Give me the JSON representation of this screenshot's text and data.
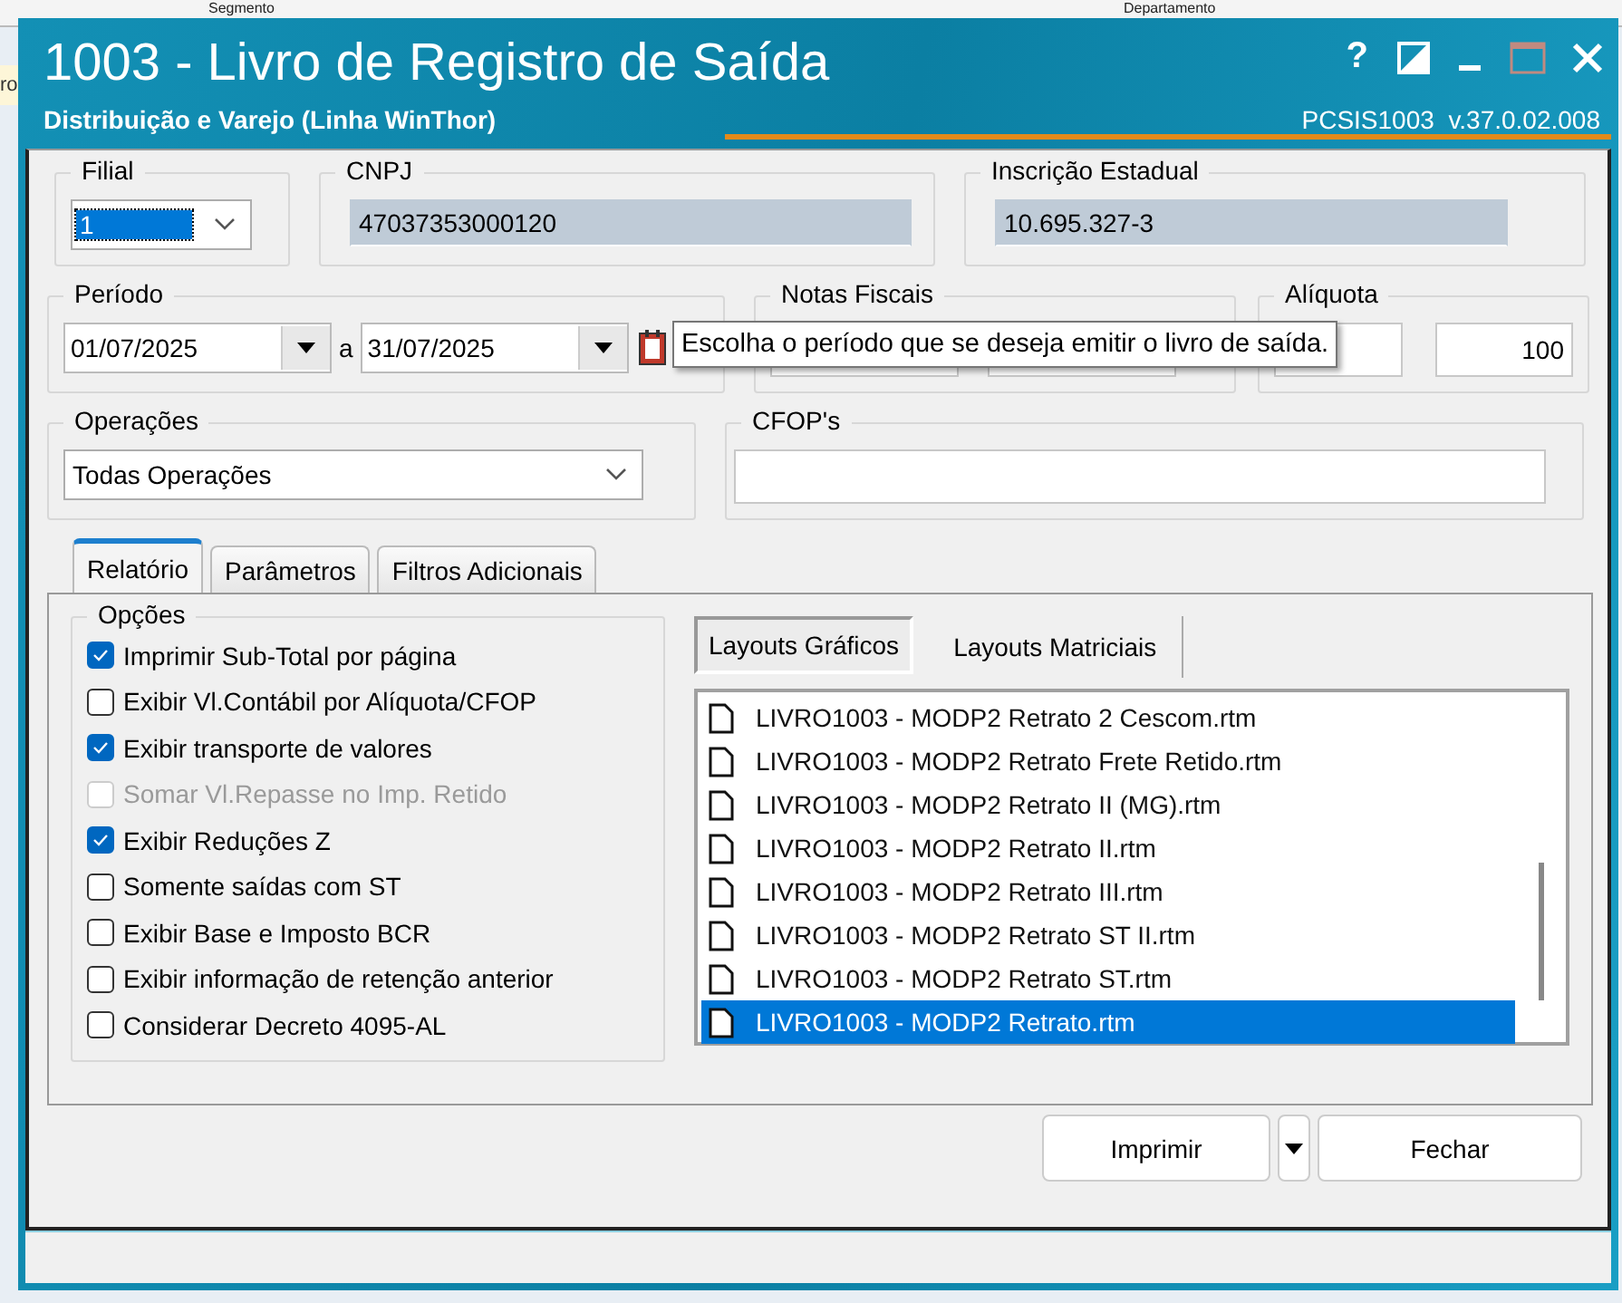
{
  "background": {
    "texts": [
      "Segmento",
      "Departamento",
      "ro"
    ]
  },
  "window": {
    "title": "1003 - Livro de Registro de Saída",
    "subtitle": "Distribuição e Varejo (Linha WinThor)",
    "help": "?",
    "version": "PCSIS1003  v.37.0.02.008"
  },
  "filial": {
    "label": "Filial",
    "value": "1",
    "value_selected": true
  },
  "cnpj": {
    "label": "CNPJ",
    "value": "47037353000120"
  },
  "inscricao": {
    "label": "Inscrição Estadual",
    "value": "10.695.327-3"
  },
  "periodo": {
    "label": "Período",
    "from": "01/07/2025",
    "separator": "a",
    "to": "31/07/2025"
  },
  "notas_fiscais": {
    "label": "Notas Fiscais"
  },
  "aliquota": {
    "label": "Alíquota",
    "to": "100"
  },
  "tooltip": {
    "text": "Escolha o período que se deseja emitir o livro de saída."
  },
  "operacoes": {
    "label": "Operações",
    "value": "Todas Operações"
  },
  "cfops": {
    "label": "CFOP's"
  },
  "tabs": [
    {
      "label": "Relatório",
      "selected": true
    },
    {
      "label": "Parâmetros",
      "selected": false
    },
    {
      "label": "Filtros Adicionais",
      "selected": false
    }
  ],
  "options": {
    "title": "Opções",
    "items": [
      {
        "label": "Imprimir Sub-Total por página",
        "checked": true,
        "disabled": false
      },
      {
        "label": "Exibir Vl.Contábil por Alíquota/CFOP",
        "checked": false,
        "disabled": false
      },
      {
        "label": "Exibir transporte de valores",
        "checked": true,
        "disabled": false
      },
      {
        "label": "Somar Vl.Repasse no Imp. Retido",
        "checked": false,
        "disabled": true
      },
      {
        "label": "Exibir Reduções Z",
        "checked": true,
        "disabled": false
      },
      {
        "label": "Somente saídas com ST",
        "checked": false,
        "disabled": false
      },
      {
        "label": "Exibir Base e Imposto BCR",
        "checked": false,
        "disabled": false
      },
      {
        "label": "Exibir informação de retenção anterior",
        "checked": false,
        "disabled": false
      },
      {
        "label": "Considerar Decreto 4095-AL",
        "checked": false,
        "disabled": false
      }
    ]
  },
  "layout_tabs": [
    {
      "label": "Layouts Gráficos",
      "selected": true
    },
    {
      "label": "Layouts Matriciais",
      "selected": false
    }
  ],
  "files": [
    {
      "name": "LIVRO1003 - MODP2 Retrato 2 Cescom.rtm",
      "selected": false
    },
    {
      "name": "LIVRO1003 - MODP2 Retrato Frete Retido.rtm",
      "selected": false
    },
    {
      "name": "LIVRO1003 - MODP2 Retrato II (MG).rtm",
      "selected": false
    },
    {
      "name": "LIVRO1003 - MODP2 Retrato II.rtm",
      "selected": false
    },
    {
      "name": "LIVRO1003 - MODP2 Retrato III.rtm",
      "selected": false
    },
    {
      "name": "LIVRO1003 - MODP2 Retrato ST II.rtm",
      "selected": false
    },
    {
      "name": "LIVRO1003 - MODP2 Retrato ST.rtm",
      "selected": false
    },
    {
      "name": "LIVRO1003 - MODP2 Retrato.rtm",
      "selected": true
    }
  ],
  "buttons": [
    {
      "label": "Imprimir"
    },
    {
      "label": "Fechar"
    }
  ]
}
